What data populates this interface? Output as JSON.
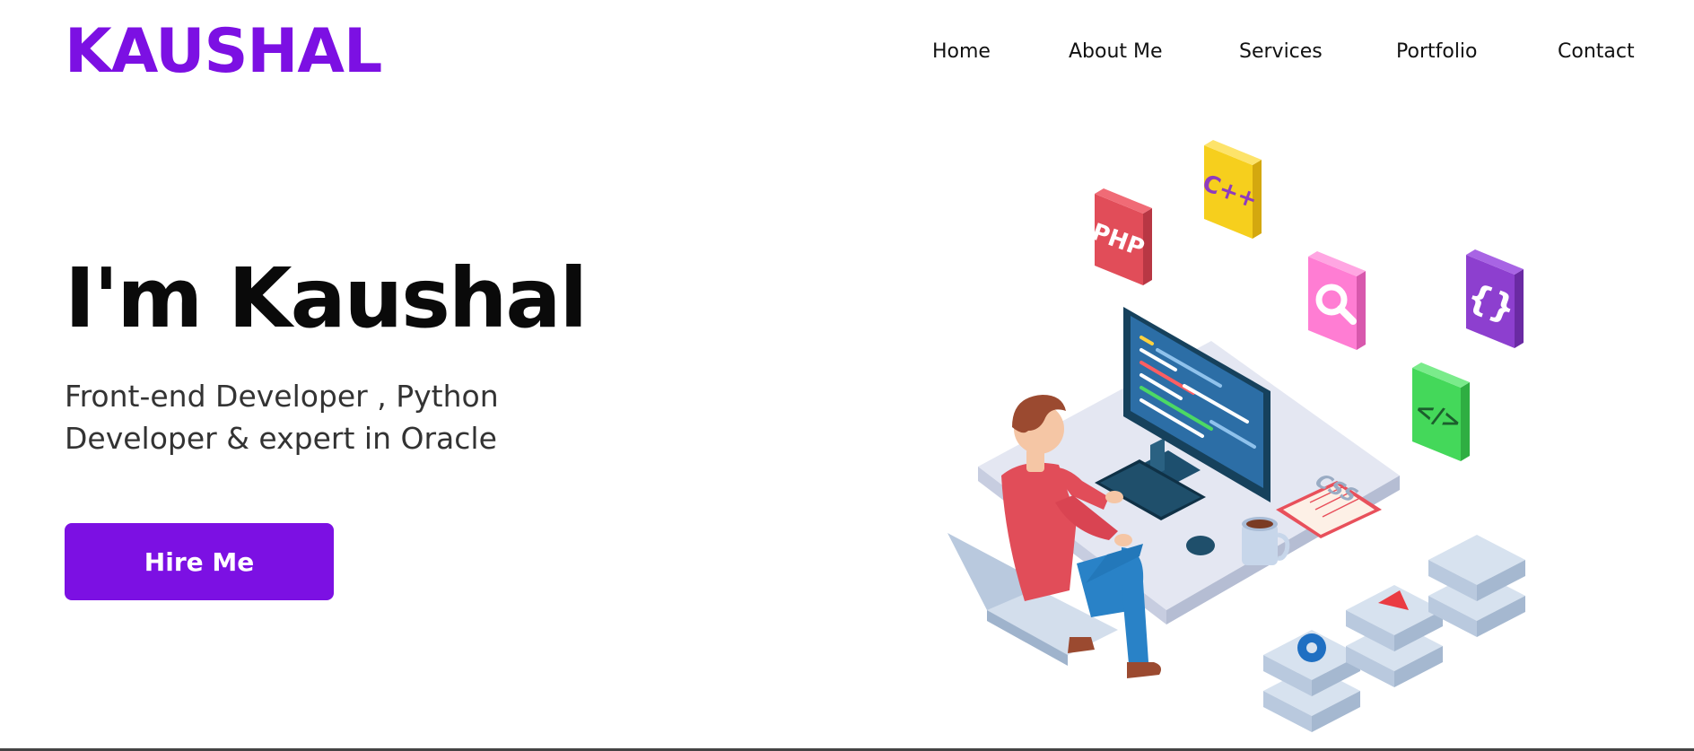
{
  "header": {
    "logo": "KAUSHAL",
    "nav": [
      {
        "label": "Home"
      },
      {
        "label": "About Me"
      },
      {
        "label": "Services"
      },
      {
        "label": "Portfolio"
      },
      {
        "label": "Contact"
      }
    ]
  },
  "hero": {
    "title": "I'm Kaushal",
    "subtitle": "Front-end Developer , Python Developer & expert in Oracle",
    "cta_label": "Hire Me"
  },
  "illustration": {
    "tiles": {
      "php": "PHP",
      "cpp": "C++",
      "braces": "{}",
      "code": "</>",
      "css": "CSS"
    }
  },
  "colors": {
    "brand": "#7c10e3",
    "button": "#7c10e3",
    "text": "#0a0a0a",
    "subtext": "#333333"
  }
}
